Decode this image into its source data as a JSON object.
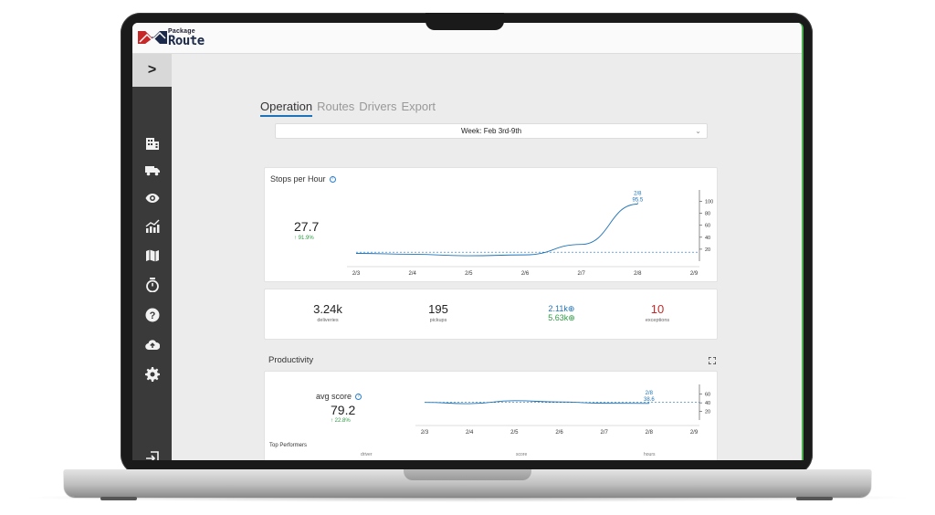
{
  "app": {
    "logo_top": "Package",
    "logo_bottom": "Route"
  },
  "sidebar": {
    "toggle_glyph": ">",
    "items": [
      {
        "icon": "building-icon"
      },
      {
        "icon": "truck-icon"
      },
      {
        "icon": "eye-icon"
      },
      {
        "icon": "analytics-icon"
      },
      {
        "icon": "map-icon"
      },
      {
        "icon": "stopwatch-icon"
      },
      {
        "icon": "help-icon"
      },
      {
        "icon": "upload-cloud-icon"
      },
      {
        "icon": "gear-icon"
      }
    ],
    "footer_icon": "logout-icon"
  },
  "tabs": [
    "Operation",
    "Routes",
    "Drivers",
    "Export"
  ],
  "active_tab": "Operation",
  "week_select": {
    "value": "Week:  Feb 3rd-9th",
    "chevron": "⌄"
  },
  "stops_per_hour": {
    "title": "Stops per Hour",
    "value": "27.7",
    "delta": "↑ 91.9%"
  },
  "kpis": {
    "deliveries_value": "3.24k",
    "deliveries_label": "deliveries",
    "pickups_value": "195",
    "pickups_label": "pickups",
    "blue_value": "2.11k",
    "green_value": "5.63k",
    "exceptions_value": "10",
    "exceptions_label": "exceptions"
  },
  "productivity": {
    "section_title": "Productivity",
    "avg_label": "avg score",
    "avg_value": "79.2",
    "avg_delta": "↑ 22.8%",
    "top_performers": "Top Performers",
    "columns": [
      "driver",
      "score",
      "hours"
    ]
  },
  "colors": {
    "accent": "#1e73b8",
    "positive": "#2e9b44",
    "negative": "#c62828",
    "sidebar": "#3a3a3a"
  },
  "chart_data": [
    {
      "type": "line",
      "title": "Stops per Hour",
      "x": [
        "2/3",
        "2/4",
        "2/5",
        "2/6",
        "2/7",
        "2/8",
        "2/9"
      ],
      "series": [
        {
          "values": [
            13,
            11.5,
            9,
            10.5,
            28,
            95.5,
            null
          ]
        }
      ],
      "reference_line": 15,
      "annotation": {
        "x": "2/8",
        "label": "2/8",
        "value": "95.5"
      },
      "yticks": [
        20,
        40,
        60,
        80,
        100
      ],
      "ylim": [
        0,
        110
      ],
      "grid": false
    },
    {
      "type": "line",
      "title": "",
      "x": [
        "2/3",
        "2/4",
        "2/5",
        "2/6",
        "2/7",
        "2/8",
        "2/9"
      ],
      "series": [
        {
          "values": [
            41,
            38,
            45,
            42,
            39,
            38.6,
            null
          ]
        }
      ],
      "reference_line": 41,
      "annotation": {
        "x": "2/8",
        "label": "2/8",
        "value": "38.6"
      },
      "yticks": [
        20,
        40,
        60
      ],
      "ylim": [
        0,
        70
      ],
      "grid": false
    }
  ]
}
